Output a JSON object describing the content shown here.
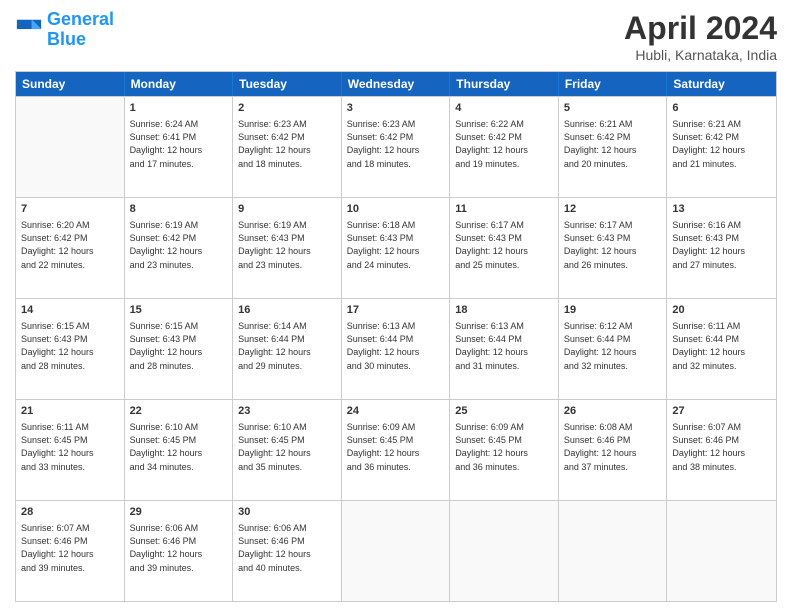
{
  "logo": {
    "line1": "General",
    "line2": "Blue"
  },
  "title": "April 2024",
  "subtitle": "Hubli, Karnataka, India",
  "headers": [
    "Sunday",
    "Monday",
    "Tuesday",
    "Wednesday",
    "Thursday",
    "Friday",
    "Saturday"
  ],
  "weeks": [
    [
      {
        "day": "",
        "info": ""
      },
      {
        "day": "1",
        "info": "Sunrise: 6:24 AM\nSunset: 6:41 PM\nDaylight: 12 hours\nand 17 minutes."
      },
      {
        "day": "2",
        "info": "Sunrise: 6:23 AM\nSunset: 6:42 PM\nDaylight: 12 hours\nand 18 minutes."
      },
      {
        "day": "3",
        "info": "Sunrise: 6:23 AM\nSunset: 6:42 PM\nDaylight: 12 hours\nand 18 minutes."
      },
      {
        "day": "4",
        "info": "Sunrise: 6:22 AM\nSunset: 6:42 PM\nDaylight: 12 hours\nand 19 minutes."
      },
      {
        "day": "5",
        "info": "Sunrise: 6:21 AM\nSunset: 6:42 PM\nDaylight: 12 hours\nand 20 minutes."
      },
      {
        "day": "6",
        "info": "Sunrise: 6:21 AM\nSunset: 6:42 PM\nDaylight: 12 hours\nand 21 minutes."
      }
    ],
    [
      {
        "day": "7",
        "info": "Sunrise: 6:20 AM\nSunset: 6:42 PM\nDaylight: 12 hours\nand 22 minutes."
      },
      {
        "day": "8",
        "info": "Sunrise: 6:19 AM\nSunset: 6:42 PM\nDaylight: 12 hours\nand 23 minutes."
      },
      {
        "day": "9",
        "info": "Sunrise: 6:19 AM\nSunset: 6:43 PM\nDaylight: 12 hours\nand 23 minutes."
      },
      {
        "day": "10",
        "info": "Sunrise: 6:18 AM\nSunset: 6:43 PM\nDaylight: 12 hours\nand 24 minutes."
      },
      {
        "day": "11",
        "info": "Sunrise: 6:17 AM\nSunset: 6:43 PM\nDaylight: 12 hours\nand 25 minutes."
      },
      {
        "day": "12",
        "info": "Sunrise: 6:17 AM\nSunset: 6:43 PM\nDaylight: 12 hours\nand 26 minutes."
      },
      {
        "day": "13",
        "info": "Sunrise: 6:16 AM\nSunset: 6:43 PM\nDaylight: 12 hours\nand 27 minutes."
      }
    ],
    [
      {
        "day": "14",
        "info": "Sunrise: 6:15 AM\nSunset: 6:43 PM\nDaylight: 12 hours\nand 28 minutes."
      },
      {
        "day": "15",
        "info": "Sunrise: 6:15 AM\nSunset: 6:43 PM\nDaylight: 12 hours\nand 28 minutes."
      },
      {
        "day": "16",
        "info": "Sunrise: 6:14 AM\nSunset: 6:44 PM\nDaylight: 12 hours\nand 29 minutes."
      },
      {
        "day": "17",
        "info": "Sunrise: 6:13 AM\nSunset: 6:44 PM\nDaylight: 12 hours\nand 30 minutes."
      },
      {
        "day": "18",
        "info": "Sunrise: 6:13 AM\nSunset: 6:44 PM\nDaylight: 12 hours\nand 31 minutes."
      },
      {
        "day": "19",
        "info": "Sunrise: 6:12 AM\nSunset: 6:44 PM\nDaylight: 12 hours\nand 32 minutes."
      },
      {
        "day": "20",
        "info": "Sunrise: 6:11 AM\nSunset: 6:44 PM\nDaylight: 12 hours\nand 32 minutes."
      }
    ],
    [
      {
        "day": "21",
        "info": "Sunrise: 6:11 AM\nSunset: 6:45 PM\nDaylight: 12 hours\nand 33 minutes."
      },
      {
        "day": "22",
        "info": "Sunrise: 6:10 AM\nSunset: 6:45 PM\nDaylight: 12 hours\nand 34 minutes."
      },
      {
        "day": "23",
        "info": "Sunrise: 6:10 AM\nSunset: 6:45 PM\nDaylight: 12 hours\nand 35 minutes."
      },
      {
        "day": "24",
        "info": "Sunrise: 6:09 AM\nSunset: 6:45 PM\nDaylight: 12 hours\nand 36 minutes."
      },
      {
        "day": "25",
        "info": "Sunrise: 6:09 AM\nSunset: 6:45 PM\nDaylight: 12 hours\nand 36 minutes."
      },
      {
        "day": "26",
        "info": "Sunrise: 6:08 AM\nSunset: 6:46 PM\nDaylight: 12 hours\nand 37 minutes."
      },
      {
        "day": "27",
        "info": "Sunrise: 6:07 AM\nSunset: 6:46 PM\nDaylight: 12 hours\nand 38 minutes."
      }
    ],
    [
      {
        "day": "28",
        "info": "Sunrise: 6:07 AM\nSunset: 6:46 PM\nDaylight: 12 hours\nand 39 minutes."
      },
      {
        "day": "29",
        "info": "Sunrise: 6:06 AM\nSunset: 6:46 PM\nDaylight: 12 hours\nand 39 minutes."
      },
      {
        "day": "30",
        "info": "Sunrise: 6:06 AM\nSunset: 6:46 PM\nDaylight: 12 hours\nand 40 minutes."
      },
      {
        "day": "",
        "info": ""
      },
      {
        "day": "",
        "info": ""
      },
      {
        "day": "",
        "info": ""
      },
      {
        "day": "",
        "info": ""
      }
    ]
  ]
}
